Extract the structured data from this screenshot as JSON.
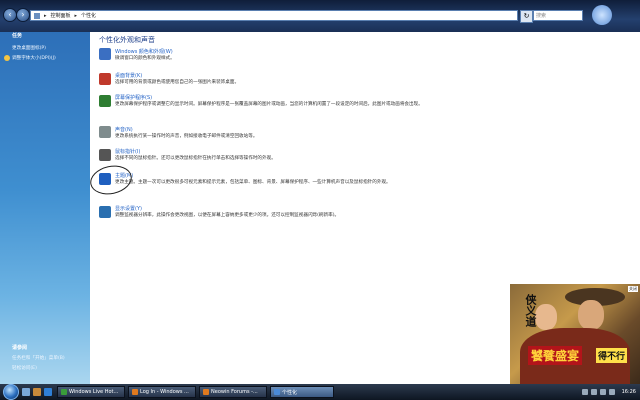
{
  "address_bar": {
    "crumbs": [
      "控制面板",
      "个性化"
    ],
    "search_placeholder": "搜索"
  },
  "sidebar": {
    "tasks_heading": "任务",
    "tasks": [
      "更改桌面图标(P)",
      "调整字体大小(DPI)(J)"
    ],
    "see_also_heading": "请参阅",
    "see_also": [
      "任务栏和「开始」菜单(B)",
      "轻松访问(E)"
    ]
  },
  "main": {
    "title": "个性化外观和声音",
    "items": [
      {
        "title": "Windows 颜色和外观(W)",
        "desc": "微调窗口的颜色和外观样式。",
        "icon_color": "#3b6fc2"
      },
      {
        "title": "桌面背景(K)",
        "desc": "选择可用的背景或颜色或使用您自己的一张图片来装饰桌面。",
        "icon_color": "#c0392b"
      },
      {
        "title": "屏幕保护程序(S)",
        "desc": "更改屏幕保护程序或调整它的显示时间。屏幕保护程序是一张覆盖屏幕的图片或动画，当您的计算机闲置了一段设定的时间后，此图片或动画将会出现。",
        "icon_color": "#2e7d32"
      },
      {
        "title": "声音(N)",
        "desc": "更改系统执行某一操作时的声音，例如接收电子邮件或清空回收站等。",
        "icon_color": "#7f8c8d"
      },
      {
        "title": "鼠标指针(I)",
        "desc": "选择不同的鼠标指针。还可以更改鼠标指针在执行单击和选择等操作时的外观。",
        "icon_color": "#555555"
      },
      {
        "title": "主题(M)",
        "desc": "更改主题。主题一次可以更改很多可视元素和提示元素，包括菜单、图标、背景、屏幕保护程序、一些计算机声音以及鼠标指针的外观。",
        "icon_color": "#1f5fbf"
      },
      {
        "title": "显示设置(Y)",
        "desc": "调整监视器分辨率，此操作会更改视图，以便在屏幕上容纳更多或更少的项。还可以控制监视器闪烁(刷新率)。",
        "icon_color": "#2a6fb0"
      }
    ]
  },
  "ad": {
    "text_vertical": "侠义道",
    "banner": "饕餮盛宴",
    "banner2": "得不行",
    "corner_label": "关闭"
  },
  "taskbar": {
    "tasks": [
      {
        "label": "Windows Live Hot...",
        "color": "#3a9d3a",
        "active": false
      },
      {
        "label": "Log In - Windows ...",
        "color": "#e07a1f",
        "active": false
      },
      {
        "label": "Neowin Forums -...",
        "color": "#e07a1f",
        "active": false
      },
      {
        "label": "个性化",
        "color": "#4a8ad8",
        "active": true
      }
    ],
    "clock": "16:26"
  }
}
